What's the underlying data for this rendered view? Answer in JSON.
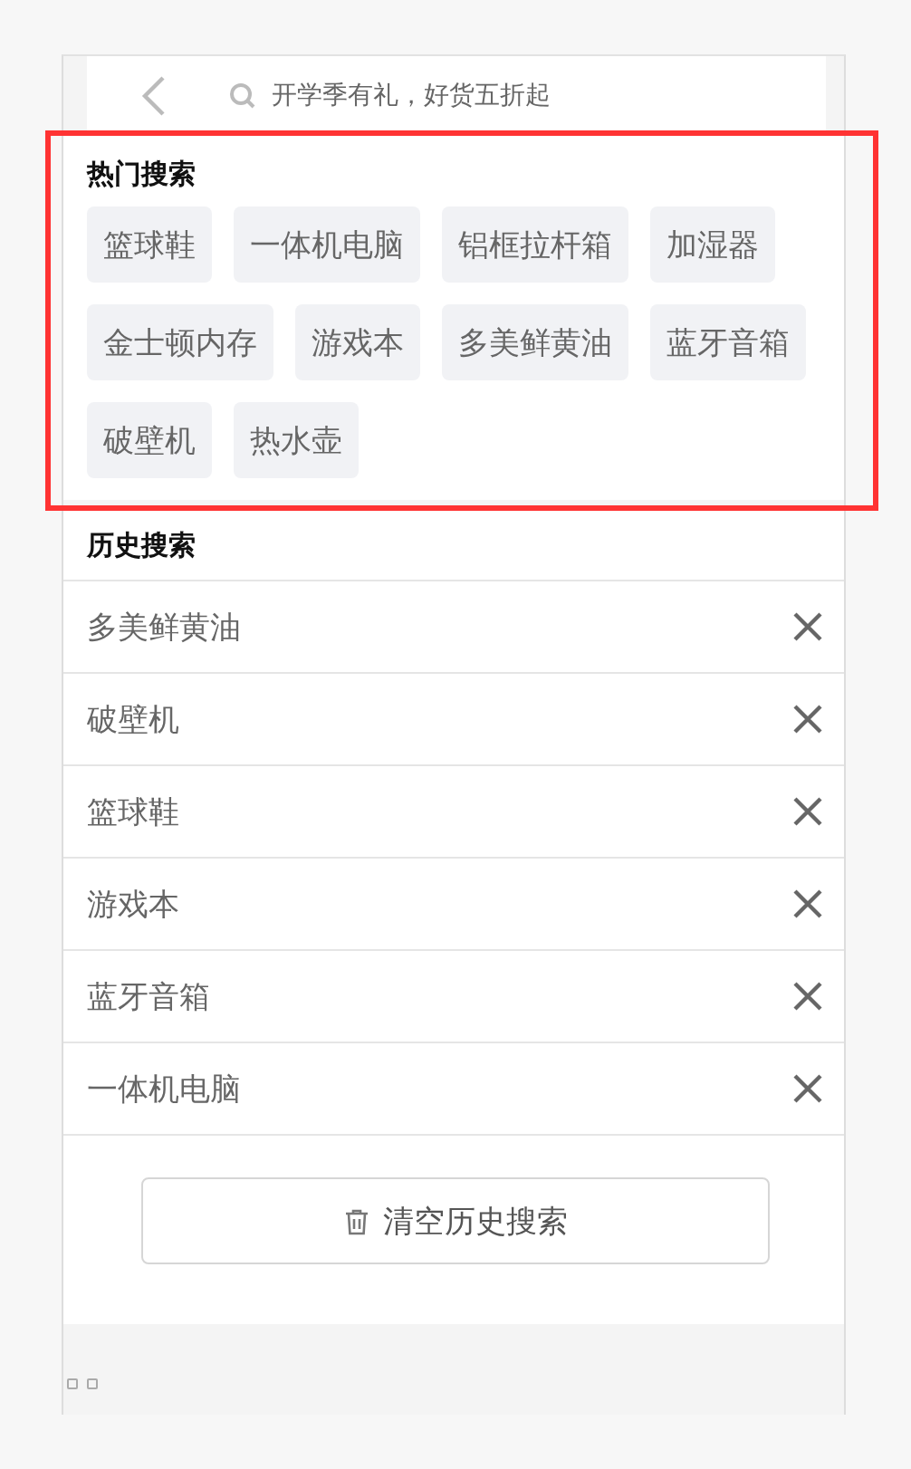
{
  "search": {
    "placeholder": "开学季有礼，好货五折起"
  },
  "hot_search": {
    "title": "热门搜索",
    "tags": [
      "篮球鞋",
      "一体机电脑",
      "铝框拉杆箱",
      "加湿器",
      "金士顿内存",
      "游戏本",
      "多美鲜黄油",
      "蓝牙音箱",
      "破壁机",
      "热水壶"
    ]
  },
  "history": {
    "title": "历史搜索",
    "items": [
      "多美鲜黄油",
      "破壁机",
      "篮球鞋",
      "游戏本",
      "蓝牙音箱",
      "一体机电脑"
    ]
  },
  "clear_button": {
    "label": "清空历史搜索"
  }
}
